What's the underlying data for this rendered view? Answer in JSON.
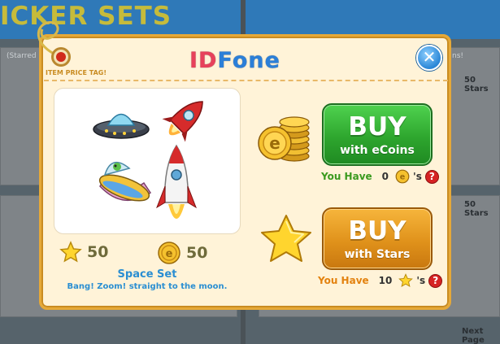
{
  "background": {
    "page_title": "ICKER SETS",
    "starred_label": "(Starred",
    "right_label": "ns!",
    "section_1_stars": "50 Stars",
    "section_2_stars": "50 Stars",
    "next_page": "Next Page"
  },
  "modal": {
    "price_tag_label": "ITEM PRICE TAG!",
    "brand_id": "ID",
    "brand_fone": "Fone",
    "close_glyph": "✕"
  },
  "item": {
    "name": "Space Set",
    "description": "Bang! Zoom! straight to the moon.",
    "star_cost": "50",
    "ecoin_cost": "50",
    "stickers": [
      "flying-saucer-icon",
      "red-rocket-icon",
      "alien-ufo-icon",
      "tall-rocket-icon"
    ]
  },
  "buy_ecoins": {
    "title": "BUY",
    "subtitle": "with eCoins",
    "have_prefix": "You Have",
    "have_value": "0",
    "have_suffix": "'s",
    "help": "?"
  },
  "buy_stars": {
    "title": "BUY",
    "subtitle": "with Stars",
    "have_prefix": "You Have",
    "have_value": "10",
    "have_suffix": "'s",
    "help": "?"
  },
  "colors": {
    "modal_bg": "#fff3d8",
    "modal_border": "#e6a938",
    "ecoins_button": "#2ea62e",
    "stars_button": "#e0921b",
    "item_text": "#2a8ed2"
  }
}
